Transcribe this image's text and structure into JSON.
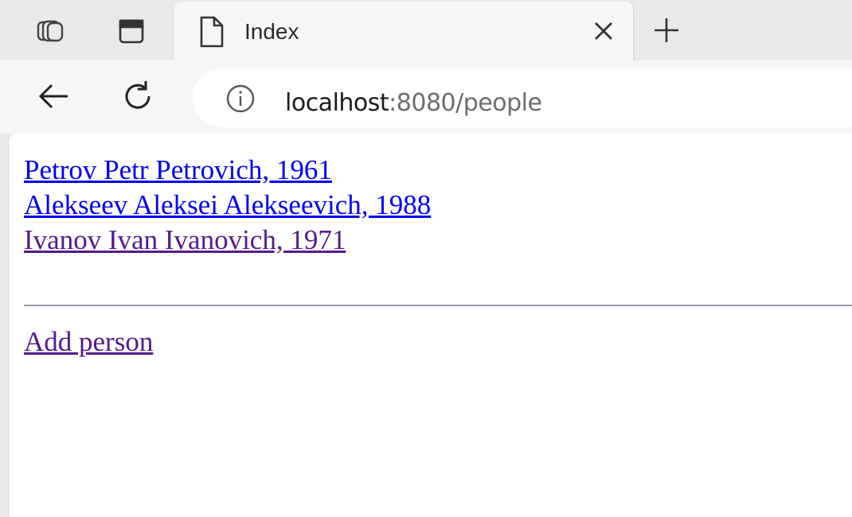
{
  "browser": {
    "tab": {
      "title": "Index",
      "icon": "page-icon"
    },
    "url": {
      "host": "localhost",
      "rest": ":8080/people"
    },
    "icons": {
      "workspaces": "workspaces-icon",
      "tab_actions": "tab-actions-icon",
      "close": "close-icon",
      "new_tab": "plus-icon",
      "back": "back-arrow-icon",
      "reload": "reload-icon",
      "info": "info-icon"
    }
  },
  "page": {
    "people": [
      {
        "label": "Petrov Petr Petrovich, 1961",
        "visited": false
      },
      {
        "label": "Alekseev Aleksei Alekseevich, 1988",
        "visited": false
      },
      {
        "label": "Ivanov Ivan Ivanovich, 1971",
        "visited": true
      }
    ],
    "add_person": "Add person"
  },
  "colors": {
    "link": "#0000ee",
    "visited_link": "#551a8b"
  }
}
